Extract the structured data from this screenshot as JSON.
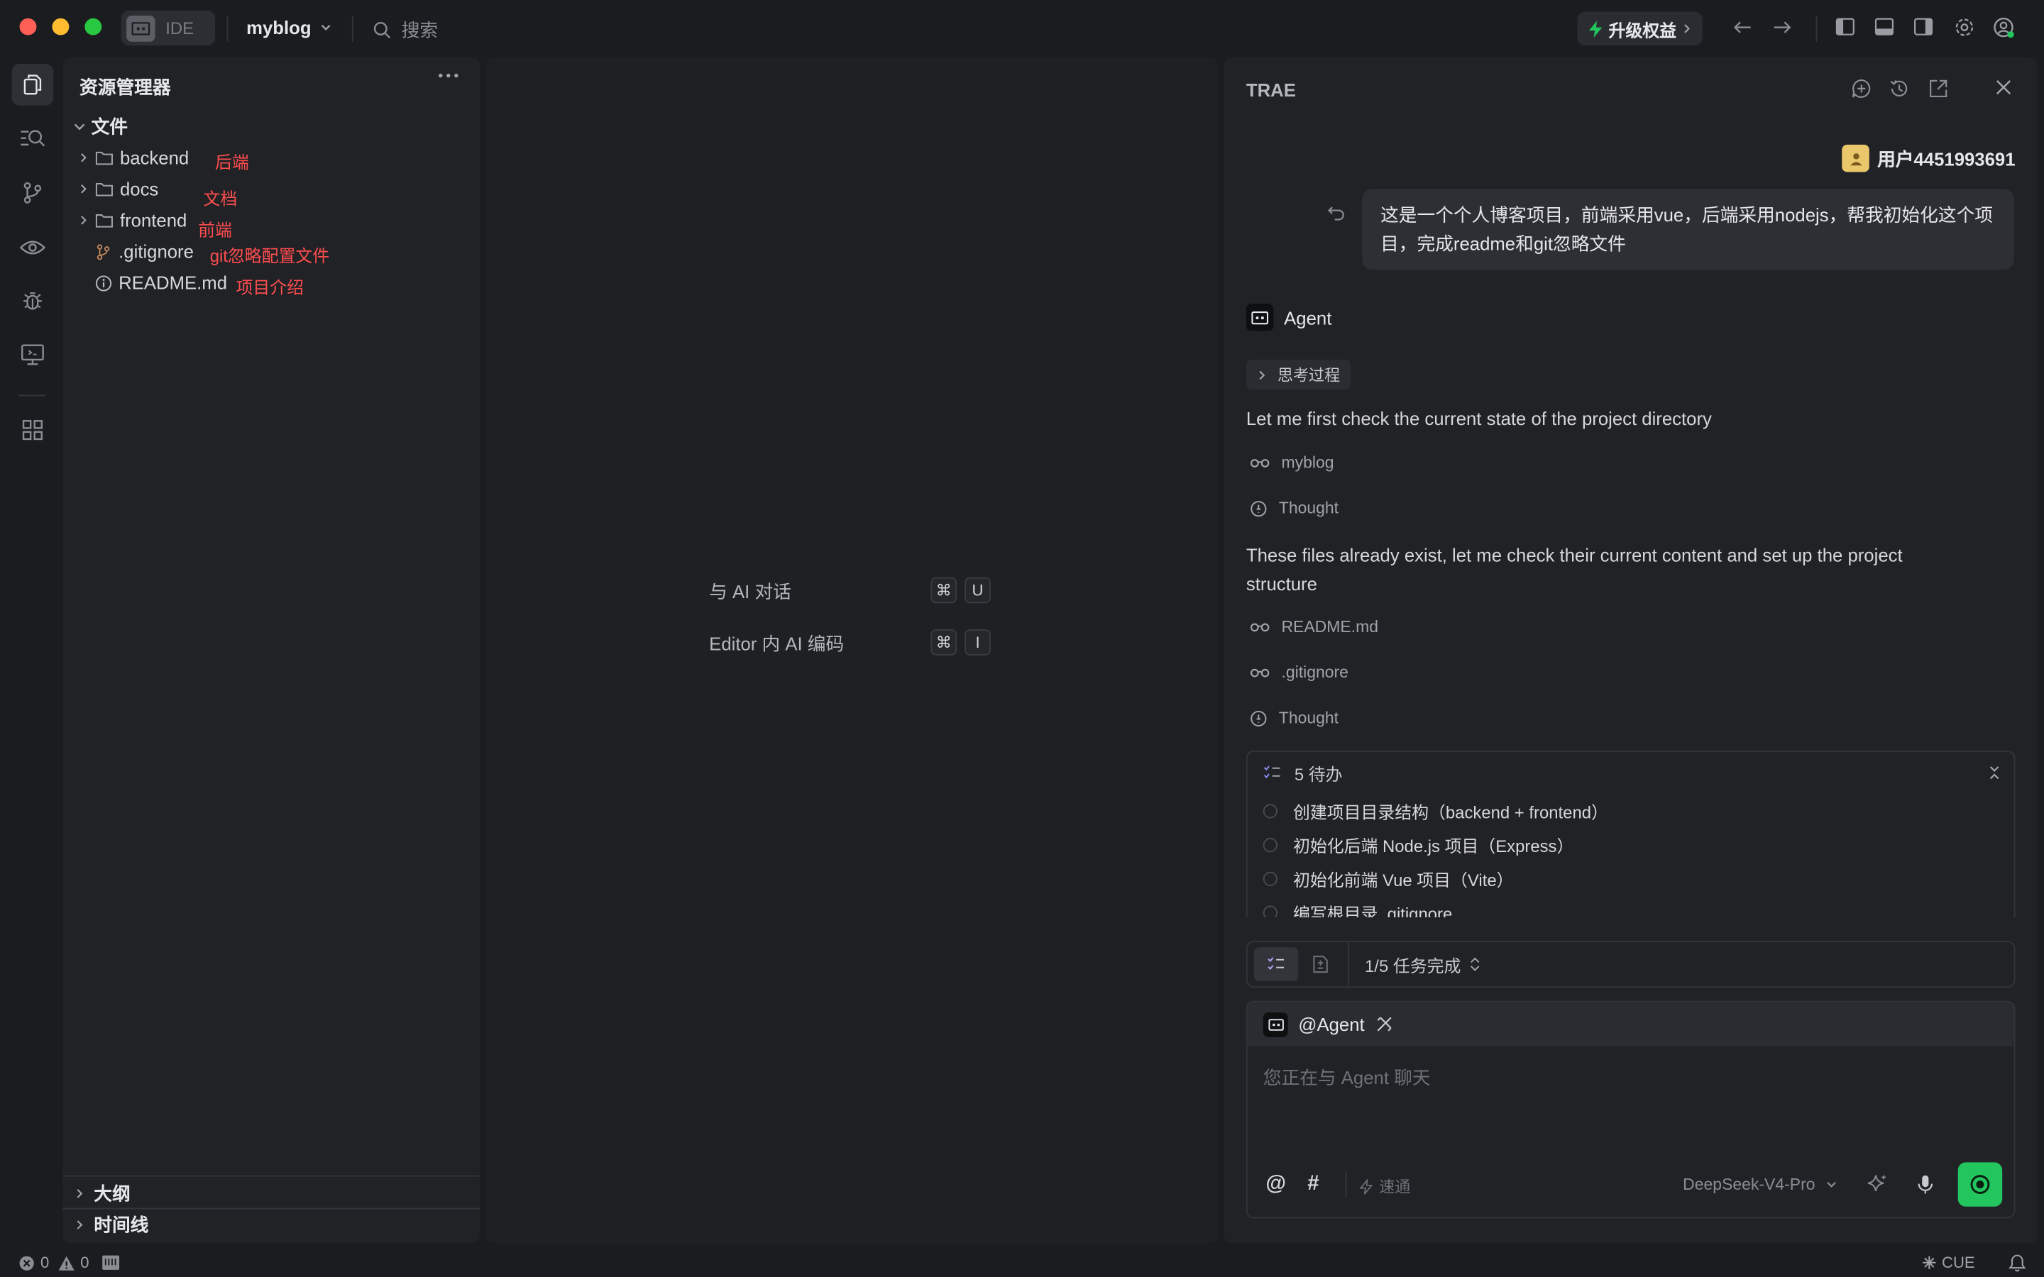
{
  "titlebar": {
    "ide_label": "IDE",
    "project": "myblog",
    "search_placeholder": "搜索",
    "upgrade_label": "升级权益"
  },
  "explorer": {
    "title": "资源管理器",
    "root": "文件",
    "items": [
      {
        "name": "backend",
        "note": "后端",
        "kind": "folder"
      },
      {
        "name": "docs",
        "note": "文档",
        "kind": "folder"
      },
      {
        "name": "frontend",
        "note": "前端",
        "kind": "folder"
      },
      {
        "name": ".gitignore",
        "note": "git忽略配置文件",
        "kind": "git"
      },
      {
        "name": "README.md",
        "note": "项目介绍",
        "kind": "info"
      }
    ],
    "outline": "大纲",
    "timeline": "时间线"
  },
  "editor": {
    "hints": [
      {
        "label": "与 AI 对话",
        "keys": [
          "⌘",
          "U"
        ]
      },
      {
        "label": "Editor 内 AI 编码",
        "keys": [
          "⌘",
          "I"
        ]
      }
    ]
  },
  "chat": {
    "title": "TRAE",
    "user_name": "用户4451993691",
    "user_message": "这是一个个人博客项目，前端采用vue，后端采用nodejs，帮我初始化这个项目，完成readme和git忽略文件",
    "agent_name": "Agent",
    "thinking_label": "思考过程",
    "msg1": "Let me first check the current state of the project directory",
    "step_myblog": "myblog",
    "thought1": "Thought",
    "msg2": "These files already exist, let me check their current content and set up the project structure",
    "step_readme": "README.md",
    "step_gitignore": ".gitignore",
    "thought2": "Thought",
    "todo_header": "5 待办",
    "todos": [
      "创建项目目录结构（backend + frontend）",
      "初始化后端 Node.js 项目（Express）",
      "初始化前端 Vue 项目（Vite）",
      "编写根目录 .gitignore"
    ],
    "progress": "1/5 任务完成",
    "composer_agent": "@Agent",
    "composer_placeholder": "您正在与 Agent 聊天",
    "speed_label": "速通",
    "model": "DeepSeek-V4-Pro"
  },
  "status": {
    "errors": "0",
    "warnings": "0",
    "cue": "CUE"
  },
  "colors": {
    "accent_green": "#22c55e",
    "annotation_red": "#ff4d4f"
  }
}
